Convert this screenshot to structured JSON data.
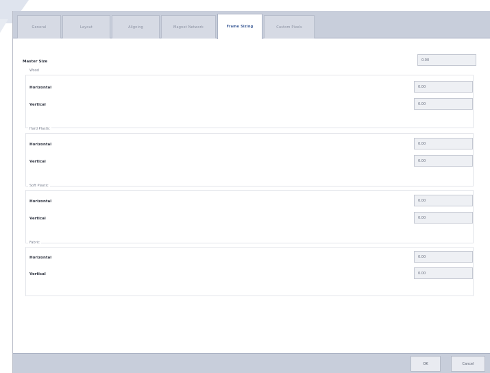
{
  "window": {
    "tabs": [
      {
        "label": "General",
        "active": false
      },
      {
        "label": "Layout",
        "active": false
      },
      {
        "label": "Aligning",
        "active": false
      },
      {
        "label": "Magnet Network",
        "active": false
      },
      {
        "label": "Frame Sizing",
        "active": true
      },
      {
        "label": "Custom Pixels",
        "active": false
      }
    ]
  },
  "master": {
    "label": "Master Size",
    "value": "0.00"
  },
  "groups": [
    {
      "title": "Wood",
      "horizontal_label": "Horizontal",
      "horizontal_value": "0.00",
      "vertical_label": "Vertical",
      "vertical_value": "0.00"
    },
    {
      "title": "Hard Plastic",
      "horizontal_label": "Horizontal",
      "horizontal_value": "0.00",
      "vertical_label": "Vertical",
      "vertical_value": "0.00"
    },
    {
      "title": "Soft Plastic",
      "horizontal_label": "Horizontal",
      "horizontal_value": "0.00",
      "vertical_label": "Vertical",
      "vertical_value": "0.00"
    },
    {
      "title": "Fabric",
      "horizontal_label": "Horizontal",
      "horizontal_value": "0.00",
      "vertical_label": "Vertical",
      "vertical_value": "0.00"
    }
  ],
  "buttons": {
    "ok": "OK",
    "cancel": "Cancel"
  },
  "colors": {
    "accent": "#3a5a96",
    "tabbar": "#c8cedb",
    "field_bg": "#eef0f4"
  }
}
